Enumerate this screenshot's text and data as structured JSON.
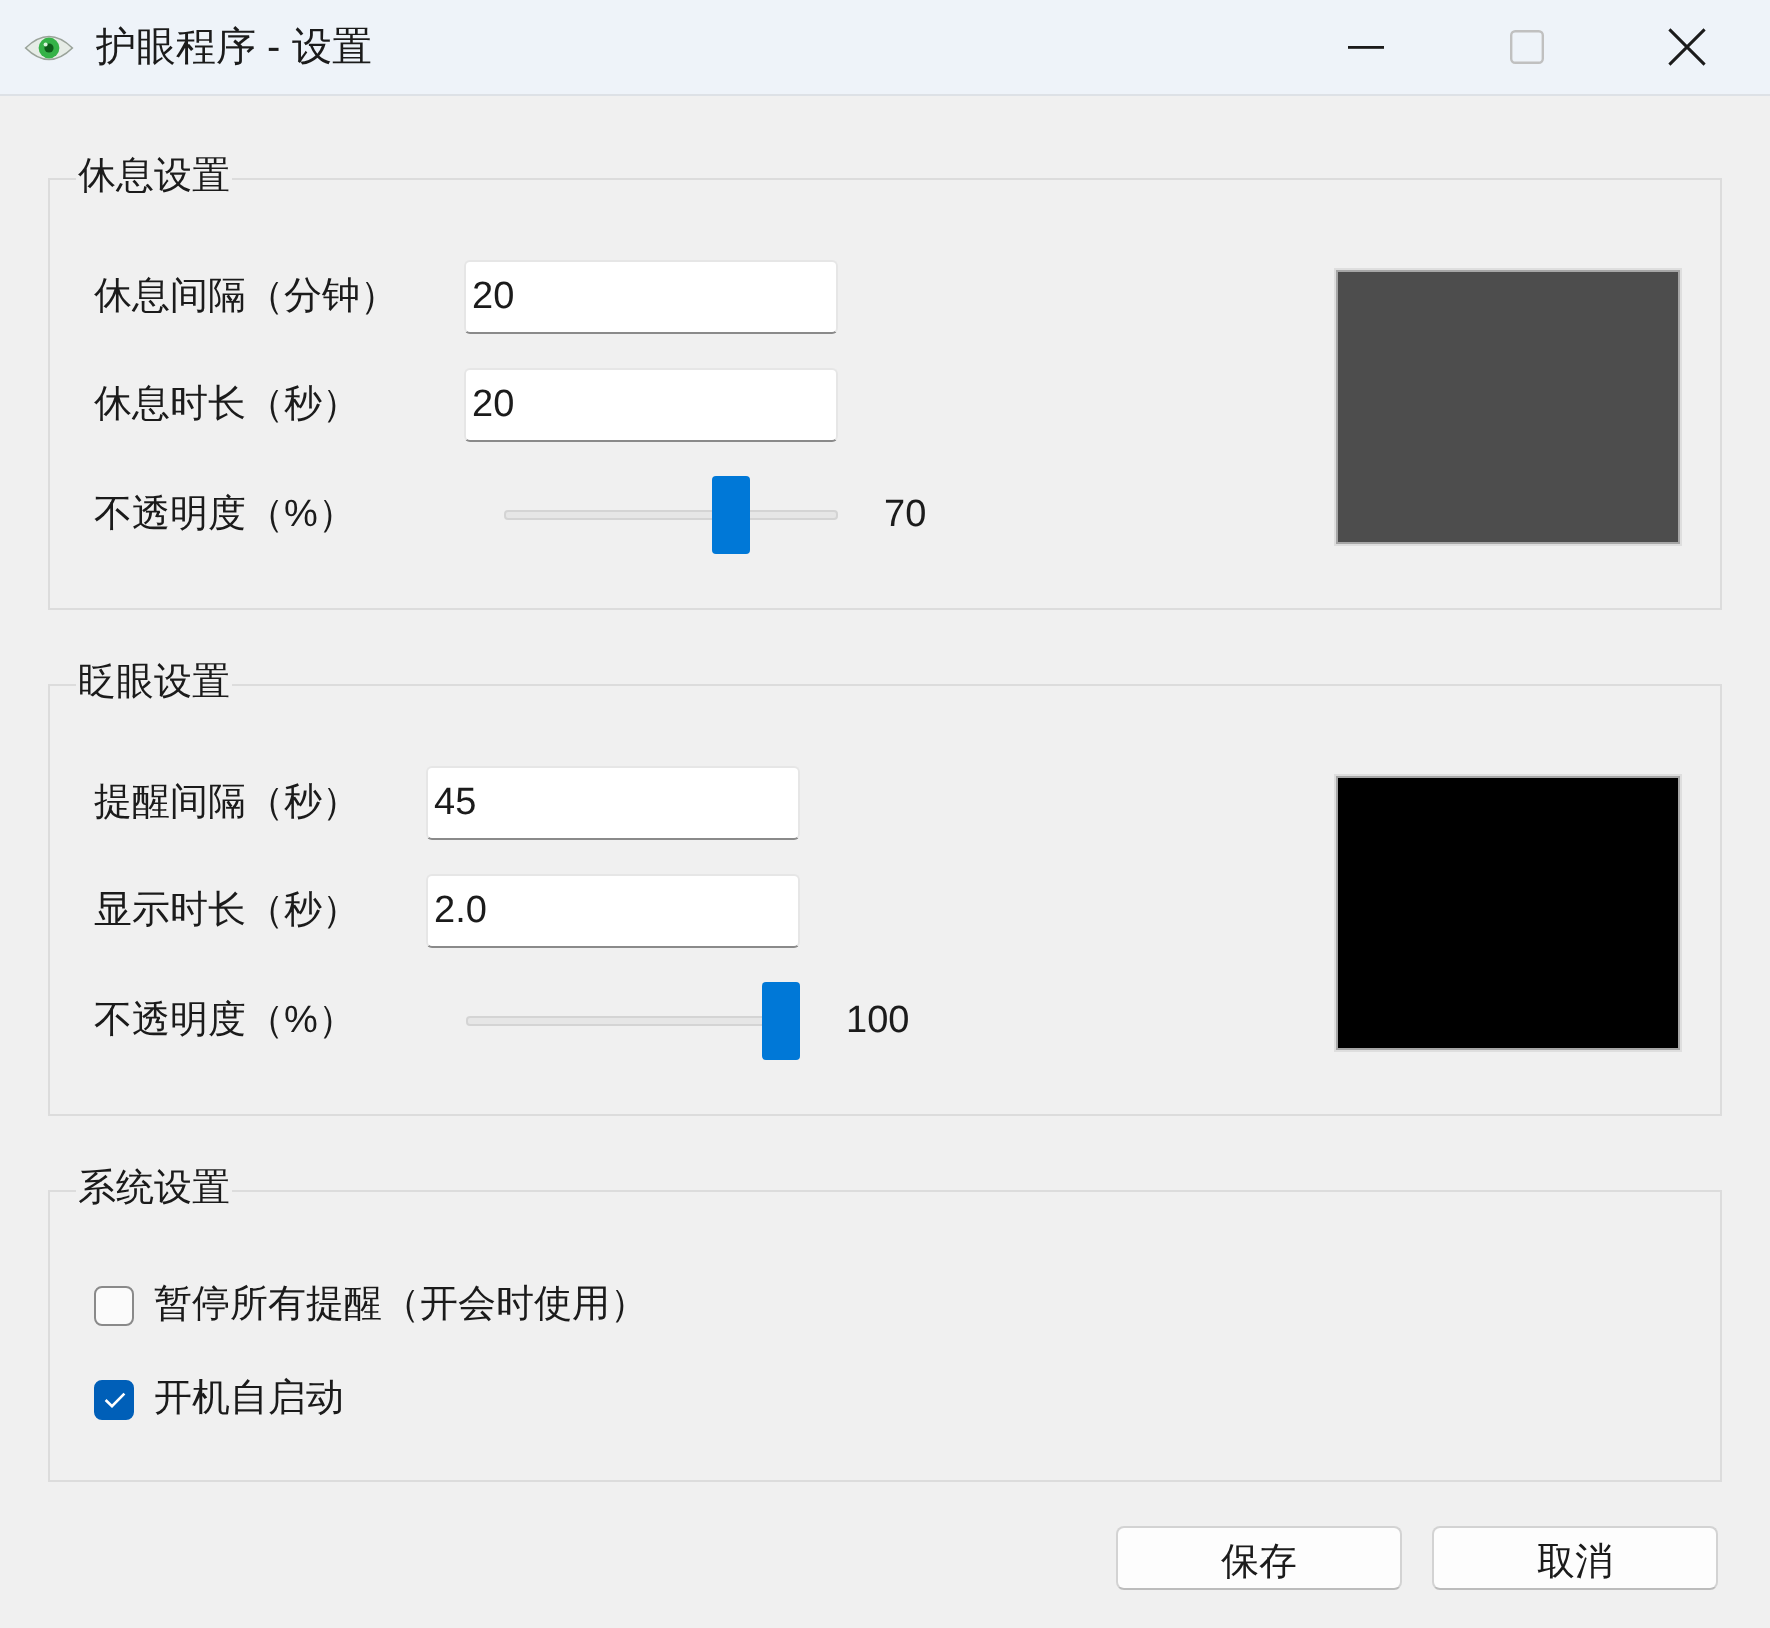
{
  "window": {
    "title": "护眼程序 - 设置",
    "maximize_disabled": true
  },
  "groups": [
    {
      "title": "休息设置",
      "rows": [
        {
          "kind": "input",
          "label": "休息间隔（分钟）",
          "value": "20"
        },
        {
          "kind": "input",
          "label": "休息时长（秒）",
          "value": "20"
        },
        {
          "kind": "slider",
          "label": "不透明度（%）",
          "level": 0.7,
          "reading": "70"
        }
      ]
    },
    {
      "title": "眨眼设置",
      "rows": [
        {
          "kind": "input",
          "label": "提醒间隔（秒）",
          "value": "45"
        },
        {
          "kind": "input",
          "label": "显示时长（秒）",
          "value": "2.0"
        },
        {
          "kind": "slider",
          "label": "不透明度（%）",
          "level": 1,
          "reading": "100"
        }
      ]
    }
  ],
  "system": {
    "title": "系统设置",
    "options": [
      {
        "label": "暂停所有提醒（开会时使用）",
        "checked": false
      },
      {
        "label": "开机自启动",
        "checked": true
      }
    ]
  },
  "buttons": [
    "保存",
    "取消"
  ]
}
